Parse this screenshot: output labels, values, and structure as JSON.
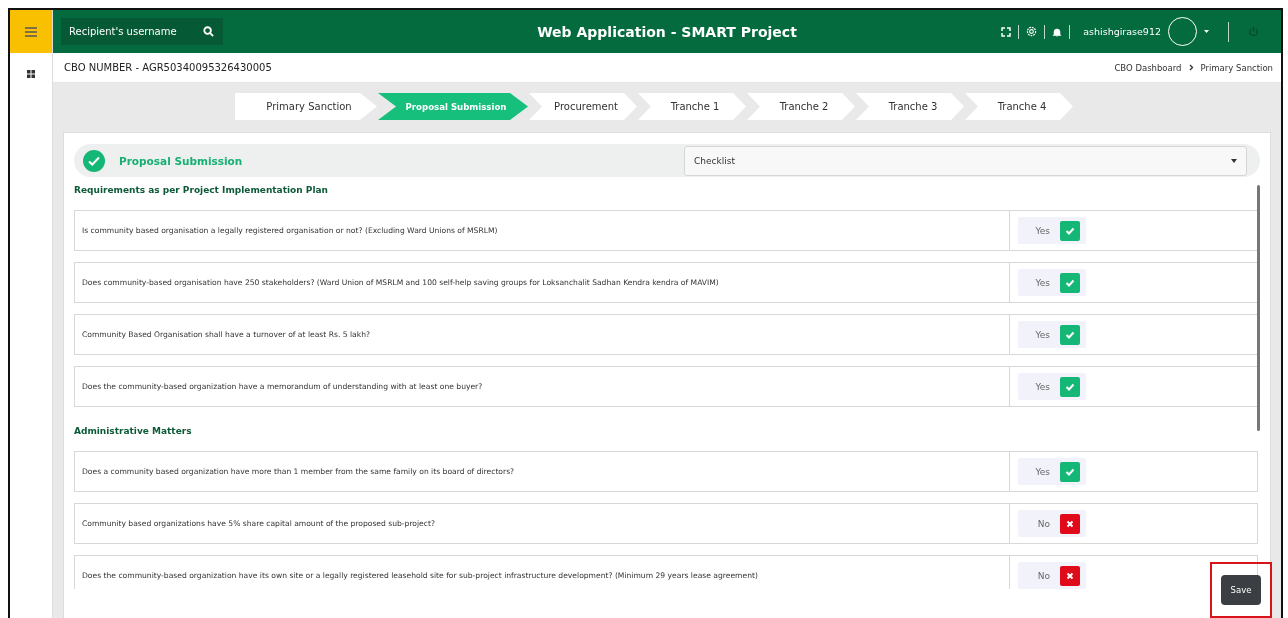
{
  "header": {
    "search": {
      "placeholder": "Recipient's username"
    },
    "title": "Web Application - SMART Project",
    "username": "ashishgirase912"
  },
  "subbar": {
    "cbo_number": "CBO NUMBER - AGR50340095326430005",
    "breadcrumb": [
      "CBO Dashboard",
      "Primary Sanction"
    ]
  },
  "steps": [
    {
      "label": "Primary Sanction",
      "selected": false
    },
    {
      "label": "Proposal Submission",
      "selected": true
    },
    {
      "label": "Procurement",
      "selected": false
    },
    {
      "label": "Tranche 1",
      "selected": false
    },
    {
      "label": "Tranche 2",
      "selected": false
    },
    {
      "label": "Tranche 3",
      "selected": false
    },
    {
      "label": "Tranche 4",
      "selected": false
    }
  ],
  "panel": {
    "title": "Proposal Submission",
    "completed": true,
    "dropdown": {
      "value": "Checklist"
    }
  },
  "sections": [
    {
      "heading": "Requirements as per Project Implementation Plan",
      "questions": [
        {
          "text": "Is community based organisation a legally registered organisation or not? (Excluding Ward Unions of MSRLM)",
          "answer": "Yes",
          "checked": true
        },
        {
          "text": "Does community-based organisation have 250 stakeholders? (Ward Union of MSRLM and 100 self-help saving groups for Loksanchalit Sadhan Kendra kendra of MAVIM)",
          "answer": "Yes",
          "checked": true
        },
        {
          "text": "Community Based Organisation shall have a turnover of at least Rs. 5 lakh?",
          "answer": "Yes",
          "checked": true
        },
        {
          "text": "Does the community-based organization have a memorandum of understanding with at least one buyer?",
          "answer": "Yes",
          "checked": true
        }
      ]
    },
    {
      "heading": "Administrative Matters",
      "questions": [
        {
          "text": "Does a community based organization have more than 1 member from the same family on its board of directors?",
          "answer": "Yes",
          "checked": true
        },
        {
          "text": "Community based organizations have 5% share capital amount of the proposed sub-project?",
          "answer": "No",
          "checked": false
        },
        {
          "text": "Does the community-based organization have its own site or a legally registered leasehold site for sub-project infrastructure development? (Minimum 29 years lease agreement)",
          "answer": "No",
          "checked": false
        }
      ]
    }
  ],
  "save_button": {
    "label": "Save",
    "highlighted": true
  }
}
